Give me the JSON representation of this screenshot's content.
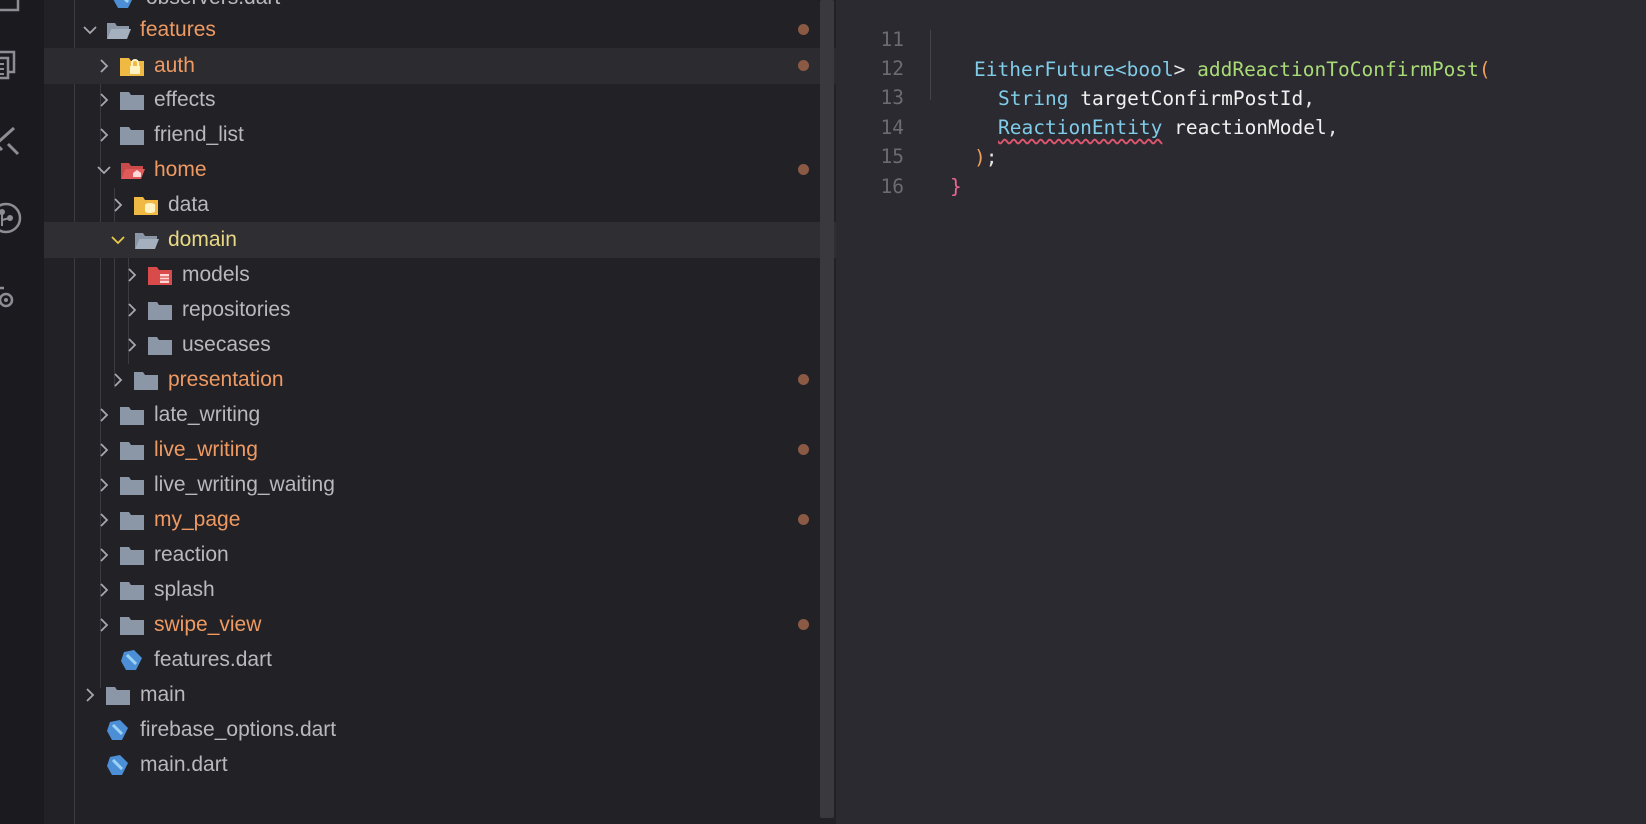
{
  "activity_bar": {
    "icons": [
      "explorer-icon",
      "copy-icon",
      "flutter-icon",
      "source-control-icon",
      "run-debug-icon"
    ]
  },
  "explorer": {
    "partial_top_file": "observers.dart",
    "rows": [
      {
        "label": "features",
        "kind": "folder-open",
        "modified": true
      },
      {
        "label": "auth",
        "kind": "folder-lock",
        "modified": true
      },
      {
        "label": "effects",
        "kind": "folder"
      },
      {
        "label": "friend_list",
        "kind": "folder"
      },
      {
        "label": "home",
        "kind": "folder-home-open",
        "modified": true
      },
      {
        "label": "data",
        "kind": "folder-database"
      },
      {
        "label": "domain",
        "kind": "folder-open"
      },
      {
        "label": "models",
        "kind": "folder-models"
      },
      {
        "label": "repositories",
        "kind": "folder"
      },
      {
        "label": "usecases",
        "kind": "folder"
      },
      {
        "label": "presentation",
        "kind": "folder",
        "modified": true
      },
      {
        "label": "late_writing",
        "kind": "folder"
      },
      {
        "label": "live_writing",
        "kind": "folder",
        "modified": true
      },
      {
        "label": "live_writing_waiting",
        "kind": "folder"
      },
      {
        "label": "my_page",
        "kind": "folder",
        "modified": true
      },
      {
        "label": "reaction",
        "kind": "folder"
      },
      {
        "label": "splash",
        "kind": "folder"
      },
      {
        "label": "swipe_view",
        "kind": "folder",
        "modified": true
      },
      {
        "label": "features.dart",
        "kind": "dart-file"
      },
      {
        "label": "main",
        "kind": "folder"
      },
      {
        "label": "firebase_options.dart",
        "kind": "dart-file"
      },
      {
        "label": "main.dart",
        "kind": "dart-file"
      }
    ]
  },
  "editor": {
    "line_numbers": [
      "11",
      "12",
      "13",
      "14",
      "15",
      "16"
    ],
    "line11": {
      "type": "EitherFuture",
      "lt": "<",
      "generic": "bool",
      "gt": ">",
      "method": "addReactionToConfirmPost",
      "paren": "("
    },
    "line12": {
      "type": "String",
      "name": "targetConfirmPostId",
      "comma": ","
    },
    "line13": {
      "type": "ReactionEntity",
      "name": "reactionModel",
      "comma": ","
    },
    "line14": {
      "paren": ")",
      "semi": ";"
    },
    "line15": {
      "brace": "}"
    }
  },
  "colors": {
    "modified": "#ee9a62",
    "selected_folder": "#e9d985",
    "modified_dot": "#8a5a45",
    "type": "#7fcbe8",
    "function": "#a9db76",
    "error_underline": "#e0566f"
  }
}
